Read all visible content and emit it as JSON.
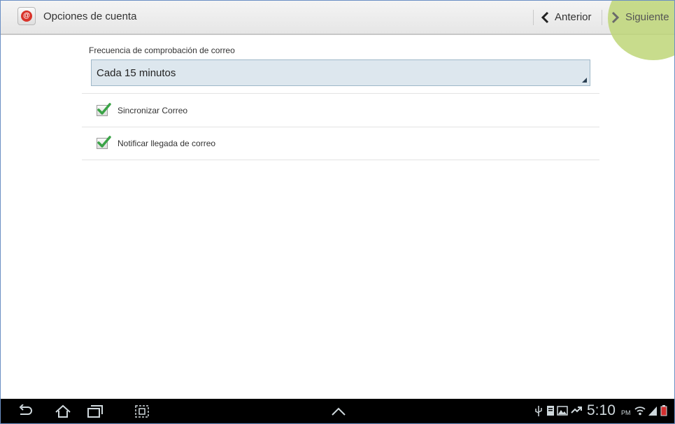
{
  "actionbar": {
    "title": "Opciones de cuenta",
    "prev_label": "Anterior",
    "next_label": "Siguiente",
    "app_icon": "email-at-icon"
  },
  "settings": {
    "frequency_label": "Frecuencia de comprobación de correo",
    "frequency_value": "Cada 15 minutos",
    "options": [
      {
        "label": "Sincronizar Correo",
        "checked": true
      },
      {
        "label": "Notificar llegada de correo",
        "checked": true
      }
    ]
  },
  "statusbar": {
    "time": "5:10",
    "ampm": "PM"
  },
  "colors": {
    "highlight": "#bed678",
    "check_green": "#3aa346",
    "select_bg": "#dde7ee"
  }
}
